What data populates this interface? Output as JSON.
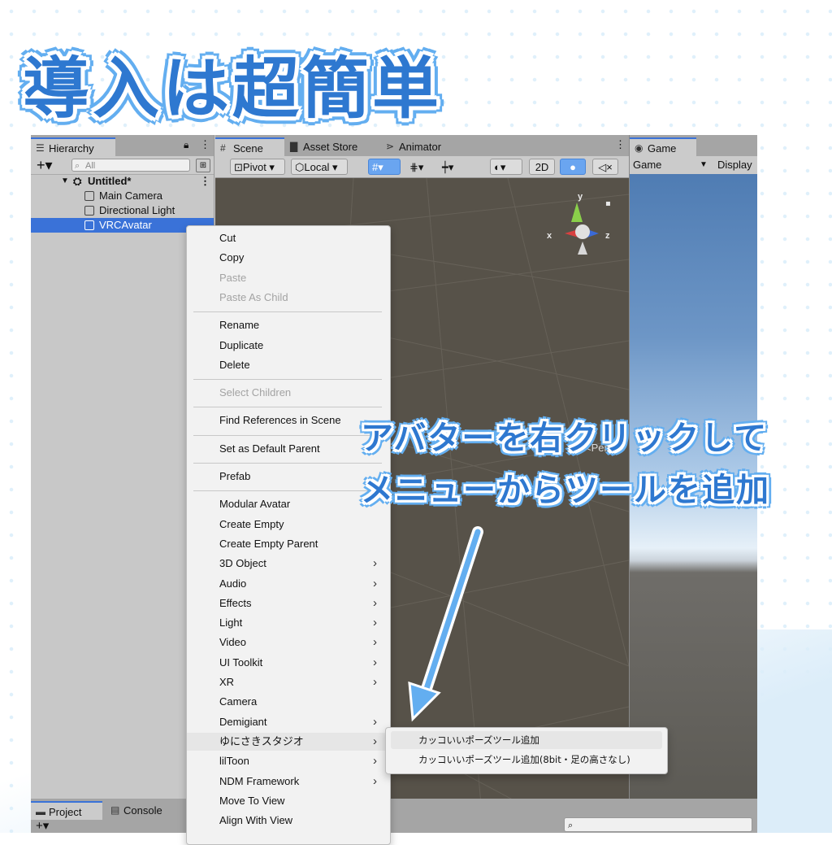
{
  "headline": "導入は超簡単",
  "annotation": {
    "line1": "アバターを右クリックして",
    "line2": "メニューからツールを追加"
  },
  "colors": {
    "accent": "#2e78d0",
    "outline": "#63aef0",
    "selection": "#3a72d8"
  },
  "hierarchy": {
    "tab_label": "Hierarchy",
    "add_label": "+▾",
    "search_placeholder": "All",
    "scene_name": "Untitled*",
    "objects": [
      "Main Camera",
      "Directional Light",
      "VRCAvatar"
    ],
    "selected": "VRCAvatar"
  },
  "scene_tabs": [
    "Scene",
    "Asset Store",
    "Animator"
  ],
  "scene_toolbar": {
    "pivot": "Pivot",
    "local": "Local",
    "mode_2d": "2D"
  },
  "gizmo": {
    "y_label": "y",
    "x_label": "x",
    "z_label": "z",
    "projection": "Persp"
  },
  "game": {
    "tab_label": "Game",
    "view_select": "Game",
    "display_label": "Display"
  },
  "bottom_tabs": [
    "Project",
    "Console"
  ],
  "context_menu": {
    "groups": [
      [
        {
          "label": "Cut",
          "disabled": false,
          "submenu": false
        },
        {
          "label": "Copy",
          "disabled": false,
          "submenu": false
        },
        {
          "label": "Paste",
          "disabled": true,
          "submenu": false
        },
        {
          "label": "Paste As Child",
          "disabled": true,
          "submenu": false
        }
      ],
      [
        {
          "label": "Rename",
          "disabled": false,
          "submenu": false
        },
        {
          "label": "Duplicate",
          "disabled": false,
          "submenu": false
        },
        {
          "label": "Delete",
          "disabled": false,
          "submenu": false
        }
      ],
      [
        {
          "label": "Select Children",
          "disabled": true,
          "submenu": false
        }
      ],
      [
        {
          "label": "Find References in Scene",
          "disabled": false,
          "submenu": false
        }
      ],
      [
        {
          "label": "Set as Default Parent",
          "disabled": false,
          "submenu": false
        }
      ],
      [
        {
          "label": "Prefab",
          "disabled": false,
          "submenu": false
        }
      ],
      [
        {
          "label": "Modular Avatar",
          "disabled": false,
          "submenu": false
        },
        {
          "label": "Create Empty",
          "disabled": false,
          "submenu": false
        },
        {
          "label": "Create Empty Parent",
          "disabled": false,
          "submenu": false
        },
        {
          "label": "3D Object",
          "disabled": false,
          "submenu": true
        },
        {
          "label": "Audio",
          "disabled": false,
          "submenu": true
        },
        {
          "label": "Effects",
          "disabled": false,
          "submenu": true
        },
        {
          "label": "Light",
          "disabled": false,
          "submenu": true
        },
        {
          "label": "Video",
          "disabled": false,
          "submenu": true
        },
        {
          "label": "UI Toolkit",
          "disabled": false,
          "submenu": true
        },
        {
          "label": "XR",
          "disabled": false,
          "submenu": true
        },
        {
          "label": "Camera",
          "disabled": false,
          "submenu": false
        },
        {
          "label": "Demigiant",
          "disabled": false,
          "submenu": true
        },
        {
          "label": "ゆにさきスタジオ",
          "disabled": false,
          "submenu": true,
          "highlighted": true
        },
        {
          "label": "lilToon",
          "disabled": false,
          "submenu": true
        },
        {
          "label": "NDM Framework",
          "disabled": false,
          "submenu": true
        },
        {
          "label": "Move To View",
          "disabled": false,
          "submenu": false
        },
        {
          "label": "Align With View",
          "disabled": false,
          "submenu": false
        }
      ]
    ],
    "submenu_icon": "chevron-right-icon"
  },
  "submenu": {
    "items": [
      "カッコいいポーズツール追加",
      "カッコいいポーズツール追加(8bit・足の高さなし)"
    ]
  }
}
